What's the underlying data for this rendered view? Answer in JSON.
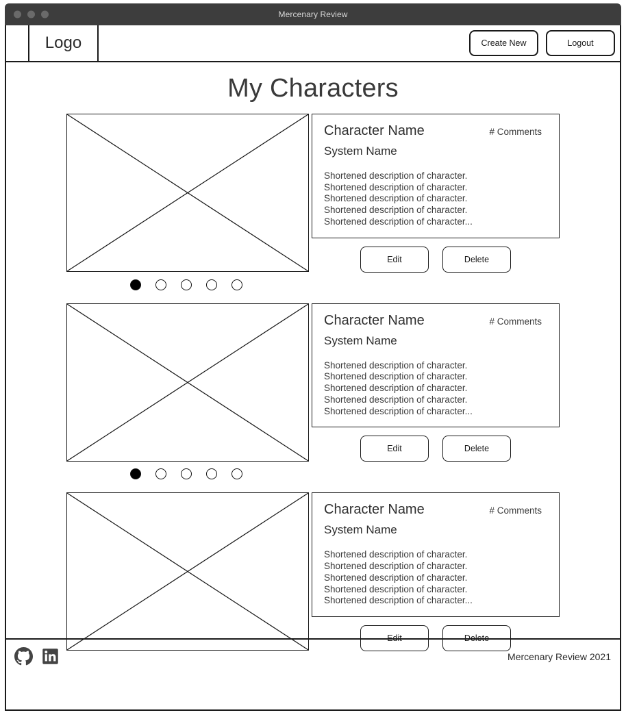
{
  "window": {
    "title": "Mercenary Review",
    "traffic_lights": [
      "close",
      "minimize",
      "maximize"
    ],
    "chrome_color": "#3d3d3d",
    "light_color": "#6a6a6a"
  },
  "navbar": {
    "logo": "Logo",
    "buttons": [
      {
        "label": "Create New",
        "name": "create-new-button"
      },
      {
        "label": "Logout",
        "name": "logout-button"
      }
    ]
  },
  "main": {
    "page_title": "My Characters"
  },
  "cards": [
    {
      "character_name": "Character Name",
      "comments": "# Comments",
      "system_name": "System Name",
      "description_lines": [
        "Shortened description of character.",
        "Shortened description of character.",
        "Shortened description of character.",
        "Shortened description of character.",
        "Shortened description of character..."
      ],
      "edit_label": "Edit",
      "delete_label": "Delete",
      "has_dots": true,
      "dot_count": 5,
      "active_dot": 0
    },
    {
      "character_name": "Character Name",
      "comments": "# Comments",
      "system_name": "System Name",
      "description_lines": [
        "Shortened description of character.",
        "Shortened description of character.",
        "Shortened description of character.",
        "Shortened description of character.",
        "Shortened description of character..."
      ],
      "edit_label": "Edit",
      "delete_label": "Delete",
      "has_dots": true,
      "dot_count": 5,
      "active_dot": 0
    },
    {
      "character_name": "Character Name",
      "comments": "# Comments",
      "system_name": "System Name",
      "description_lines": [
        "Shortened description of character.",
        "Shortened description of character.",
        "Shortened description of character.",
        "Shortened description of character.",
        "Shortened description of character..."
      ],
      "edit_label": "Edit",
      "delete_label": "Delete",
      "has_dots": false,
      "dot_count": 0,
      "active_dot": 0
    }
  ],
  "footer": {
    "icons": [
      "github-icon",
      "linkedin-icon"
    ],
    "copyright": "Mercenary Review 2021",
    "icon_color": "#444444"
  },
  "colors": {
    "border": "#1a1a1a",
    "text": "#2f2f2f",
    "muted": "#3a3a3a",
    "background": "#ffffff"
  }
}
